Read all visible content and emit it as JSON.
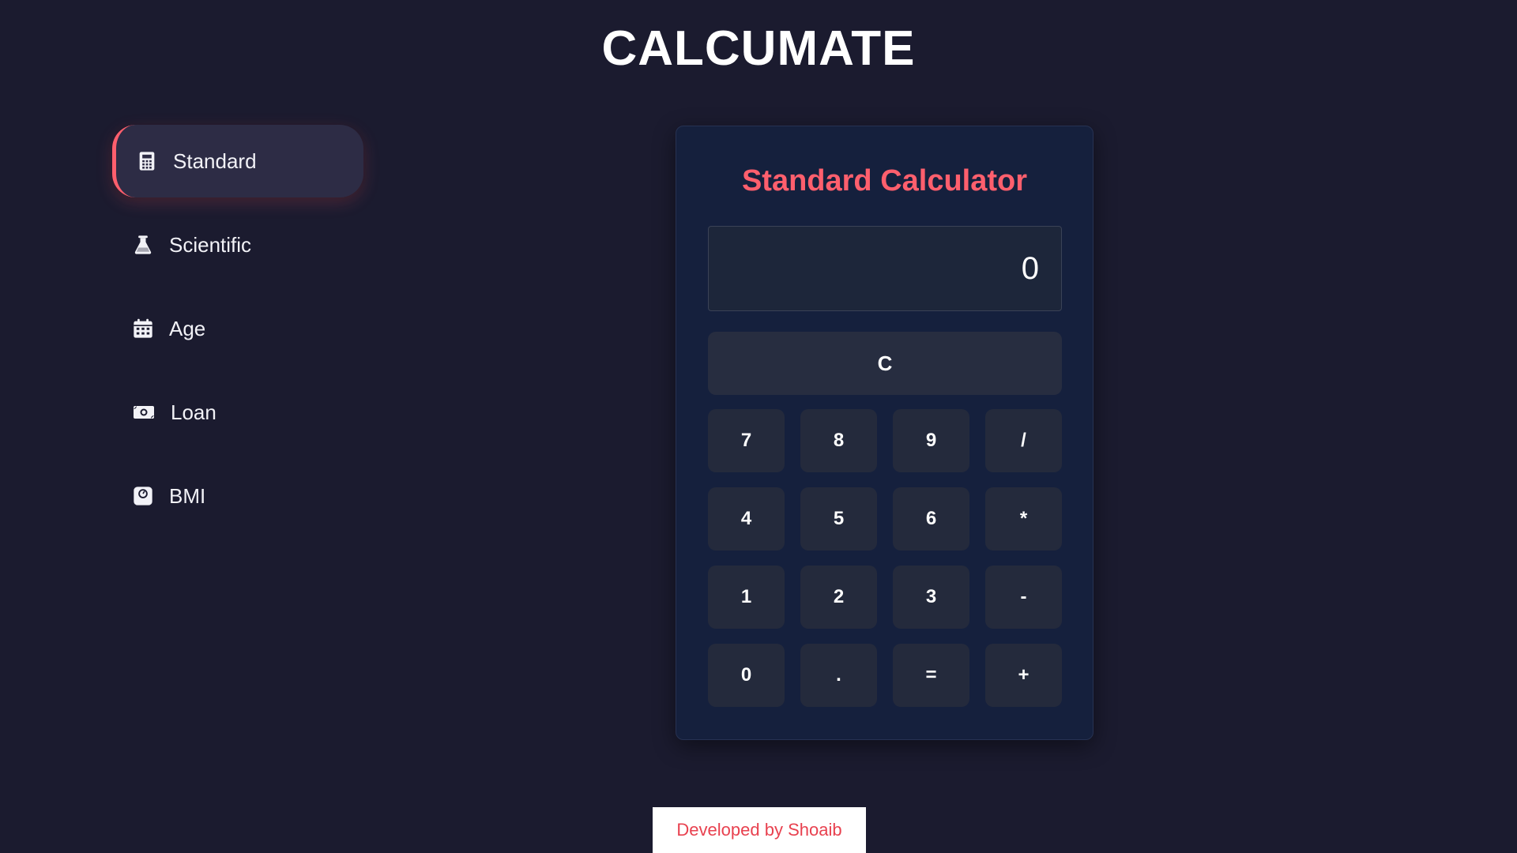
{
  "app": {
    "title": "CALCUMATE"
  },
  "sidebar": {
    "items": [
      {
        "label": "Standard",
        "icon": "calculator-icon",
        "active": true
      },
      {
        "label": "Scientific",
        "icon": "flask-icon",
        "active": false
      },
      {
        "label": "Age",
        "icon": "calendar-icon",
        "active": false
      },
      {
        "label": "Loan",
        "icon": "money-bill-icon",
        "active": false
      },
      {
        "label": "BMI",
        "icon": "weight-scale-icon",
        "active": false
      }
    ]
  },
  "calculator": {
    "title": "Standard Calculator",
    "display_value": "0",
    "clear_label": "C",
    "keys": [
      "7",
      "8",
      "9",
      "/",
      "4",
      "5",
      "6",
      "*",
      "1",
      "2",
      "3",
      "-",
      "0",
      ".",
      "=",
      "+"
    ]
  },
  "footer": {
    "text": "Developed by Shoaib"
  },
  "colors": {
    "accent": "#ff5f6d",
    "background": "#1b1b2f",
    "card": "#15203d",
    "key": "#242a3c"
  }
}
